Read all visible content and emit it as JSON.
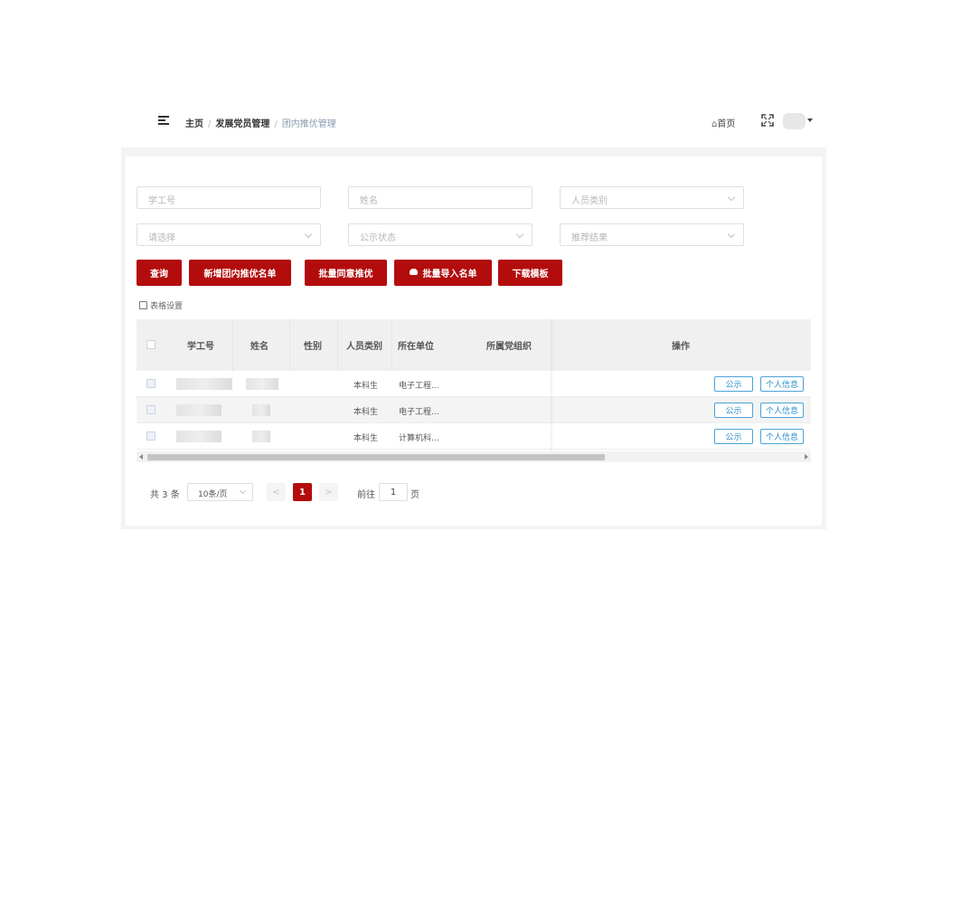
{
  "breadcrumb": {
    "items": [
      "主页",
      "发展党员管理"
    ],
    "current": "团内推优管理",
    "separator": "/"
  },
  "header": {
    "home_label": "首页"
  },
  "filters": {
    "student_id_placeholder": "学工号",
    "name_placeholder": "姓名",
    "person_type_placeholder": "人员类别",
    "select_placeholder": "请选择",
    "publicity_status_placeholder": "公示状态",
    "recommend_result_placeholder": "推荐结果"
  },
  "toolbar": {
    "query": "查询",
    "add": "新增团内推优名单",
    "batch_agree": "批量同意推优",
    "batch_import": "批量导入名单",
    "download_template": "下载模板",
    "table_settings": "表格设置"
  },
  "table": {
    "columns": [
      "学工号",
      "姓名",
      "性别",
      "人员类别",
      "所在单位",
      "所属党组织",
      "操作"
    ],
    "rows": [
      {
        "type": "本科生",
        "unit": "电子工程..."
      },
      {
        "type": "本科生",
        "unit": "电子工程..."
      },
      {
        "type": "本科生",
        "unit": "计算机科..."
      }
    ],
    "actions": {
      "publicity": "公示",
      "personal_info": "个人信息"
    }
  },
  "pagination": {
    "total": "共 3 条",
    "page_size": "10条/页",
    "current_page": "1",
    "goto_prefix": "前往",
    "goto_value": "1",
    "goto_suffix": "页",
    "prev": "<",
    "next": ">"
  },
  "colors": {
    "primary": "#b30c0c",
    "link_blue": "#2d8fcc"
  }
}
